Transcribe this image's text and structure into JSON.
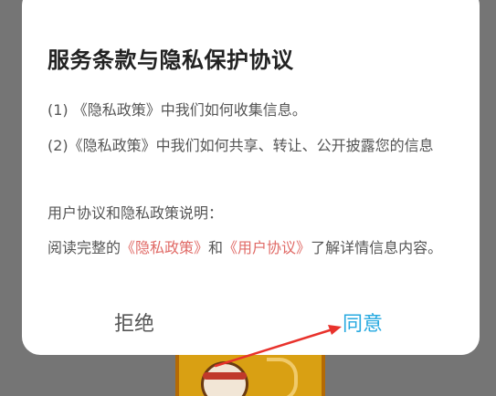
{
  "dialog": {
    "title": "服务条款与隐私保护协议",
    "item1": "(1) 《隐私政策》中我们如何收集信息。",
    "item2": "(2)《隐私政策》中我们如何共享、转让、公开披露您的信息",
    "summary_heading": "用户协议和隐私政策说明：",
    "summary_prefix": "阅读完整的",
    "privacy_link": "《隐私政策》",
    "summary_and": "和",
    "user_agreement_link": "《用户协议》",
    "summary_suffix": "了解详情信息内容。",
    "reject_label": "拒绝",
    "agree_label": "同意"
  },
  "colors": {
    "link": "#e06a66",
    "agree": "#26a9e0",
    "annotation_arrow": "#e8322c",
    "overlay": "#757575"
  }
}
